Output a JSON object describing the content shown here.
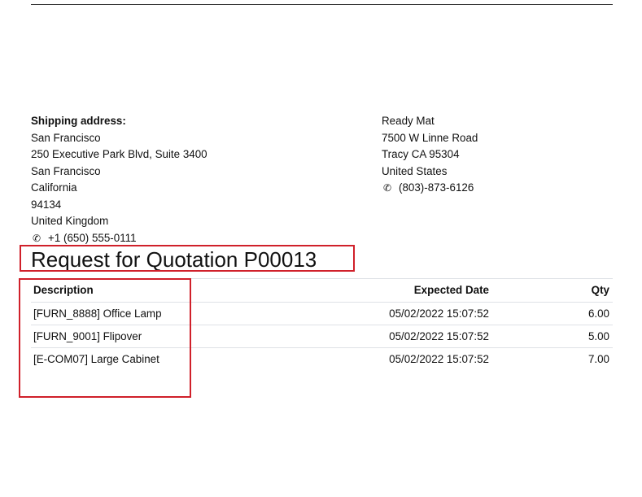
{
  "shipping": {
    "heading": "Shipping address:",
    "lines": [
      "San Francisco",
      "250 Executive Park Blvd, Suite 3400",
      "San Francisco",
      "California",
      "94134",
      "United Kingdom"
    ],
    "phone": "+1 (650) 555-0111",
    "phone_icon": "phone-icon"
  },
  "vendor": {
    "lines": [
      "Ready Mat",
      "7500 W Linne Road",
      "Tracy CA 95304",
      "United States"
    ],
    "phone": "(803)-873-6126",
    "phone_icon": "phone-icon"
  },
  "document": {
    "title": "Request for Quotation P00013"
  },
  "table": {
    "headers": {
      "description": "Description",
      "expected_date": "Expected Date",
      "qty": "Qty"
    },
    "rows": [
      {
        "description": "[FURN_8888] Office Lamp",
        "expected_date": "05/02/2022 15:07:52",
        "qty": "6.00"
      },
      {
        "description": "[FURN_9001] Flipover",
        "expected_date": "05/02/2022 15:07:52",
        "qty": "5.00"
      },
      {
        "description": "[E-COM07] Large Cabinet",
        "expected_date": "05/02/2022 15:07:52",
        "qty": "7.00"
      }
    ]
  },
  "annotations": {
    "highlight_color": "#d0202a"
  }
}
